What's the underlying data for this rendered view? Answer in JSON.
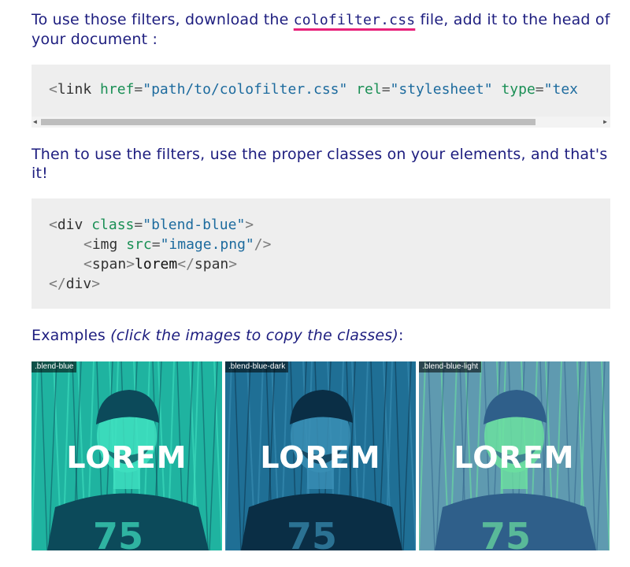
{
  "intro": {
    "before": "To use those filters, download the ",
    "filename": "colofilter.css",
    "after": " file, add it to the head of your document :"
  },
  "code1": {
    "open": "<",
    "tag": "link",
    "sp1": " ",
    "attr1": "href",
    "eq": "=",
    "val1": "\"path/to/colofilter.css\"",
    "sp2": " ",
    "attr2": "rel",
    "val2": "\"stylesheet\"",
    "sp3": " ",
    "attr3": "type",
    "val3": "\"tex"
  },
  "usage": {
    "text": "Then to use the filters, use the proper classes on your elements, and that's it!"
  },
  "code2": {
    "lt": "<",
    "gt": ">",
    "slashgt": "/>",
    "ltslash": "</",
    "div": "div",
    "class_attr": "class",
    "class_val": "\"blend-blue\"",
    "img": "img",
    "src_attr": "src",
    "src_val": "\"image.png\"",
    "span": "span",
    "span_text": "lorem",
    "eq": "="
  },
  "examples": {
    "label": "Examples ",
    "hint": "(click the images to copy the classes)",
    "colon": ":",
    "items": [
      {
        "class_label": ".blend-blue",
        "word": "LOREM",
        "bg": "#1fb3a0",
        "shade": "#0c4a5a",
        "light": "#3fe0c0"
      },
      {
        "class_label": ".blend-blue-dark",
        "word": "LOREM",
        "bg": "#1f6f95",
        "shade": "#0a2e45",
        "light": "#3a8fb5"
      },
      {
        "class_label": ".blend-blue-light",
        "word": "LOREM",
        "bg": "#5f9ab0",
        "shade": "#2f5f8a",
        "light": "#6be0a0"
      }
    ]
  }
}
